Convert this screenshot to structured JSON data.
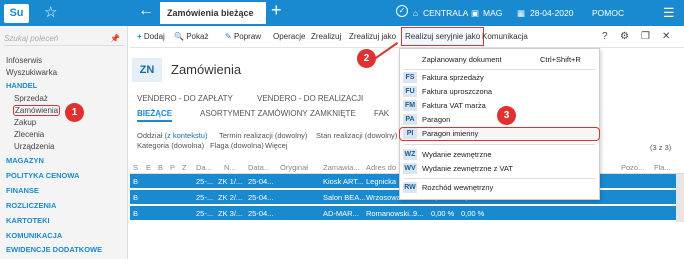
{
  "app": {
    "logo": "Su",
    "tab_title": "Zamówienia bieżące",
    "status": {
      "centrala": "CENTRALA",
      "mag": "MAG",
      "date": "28-04-2020",
      "help": "POMOC"
    }
  },
  "sidebar": {
    "search_placeholder": "Szukaj poleceń",
    "items": [
      "Infoserwis",
      "Wyszukiwarka"
    ],
    "handel_header": "HANDEL",
    "handel_items": [
      "Sprzedaż",
      "Zamówienia",
      "Zakup",
      "Zlecenia",
      "Urządzenia"
    ],
    "sections": [
      "MAGAZYN",
      "POLITYKA CENOWA",
      "FINANSE",
      "ROZLICZENIA",
      "KARTOTEKI",
      "KOMUNIKACJA",
      "EWIDENCJE DODATKOWE"
    ]
  },
  "toolbar": {
    "add": "Dodaj",
    "show": "Pokaż",
    "fix": "Popraw",
    "operations": "Operacje",
    "realize": "Zrealizuj",
    "realize_as": "Zrealizuj jako",
    "realize_serial_as": "Realizuj seryjnie jako",
    "communication": "Komunikacja",
    "help_q": "?"
  },
  "main": {
    "badge": "ZN",
    "title": "Zamówienia",
    "subtabs": [
      "VENDERO - DO ZAPŁATY",
      "VENDERO - DO REALIZACJI"
    ],
    "tabs": [
      "BIEŻĄCE",
      "ASORTYMENT ZAMÓWIONY",
      "ZAMKNIĘTE",
      "FAK"
    ],
    "filters": {
      "line1": [
        "Oddział",
        "(z kontekstu)",
        "Termin realizacji (dowolny)",
        "Stan realizacji (dowolny)",
        "Fa"
      ],
      "line2": [
        "Kategoria (dowolna)",
        "Flaga (dowolna)",
        "Więcej"
      ],
      "count": "(3 z 3)"
    }
  },
  "grid": {
    "headers": [
      "S",
      "E",
      "B",
      "P",
      "Z",
      "Da...",
      "N...",
      "Data...",
      "Oryginał",
      "Zamawia...",
      "Adres do",
      "Pozo...",
      "Fla..."
    ],
    "rows": [
      {
        "b": "B",
        "d": "25-...",
        "n": "ZK 1/...",
        "data": "25-04...",
        "zam": "Kiosk ART...",
        "adr": "Legnicka",
        "extra": "",
        "pct1": "",
        "pct2": ""
      },
      {
        "b": "B",
        "d": "25-...",
        "n": "ZK 2/...",
        "data": "25-04...",
        "zam": "Salon BEA...",
        "adr": "Wrzosowa 4...",
        "extra": "4...",
        "pct1": "0,00 %",
        "pct2": "0,00 %"
      },
      {
        "b": "B",
        "d": "25-...",
        "n": "ZK 3/...",
        "data": "25-04...",
        "zam": "AD-MAR...",
        "adr": "Romanowski...",
        "extra": "9...",
        "pct1": "0,00 %",
        "pct2": "0,00 %"
      }
    ]
  },
  "dropdown": {
    "items": [
      {
        "code": "",
        "label": "Zaplanowany dokument",
        "shortcut": "Ctrl+Shift+R"
      },
      {
        "code": "FS",
        "label": "Faktura sprzedaży"
      },
      {
        "code": "FU",
        "label": "Faktura uproszczona"
      },
      {
        "code": "FM",
        "label": "Faktura VAT marża"
      },
      {
        "code": "PA",
        "label": "Paragon"
      },
      {
        "code": "PI",
        "label": "Paragon imienny"
      },
      {
        "code": "WZ",
        "label": "Wydanie zewnętrzne"
      },
      {
        "code": "WV",
        "label": "Wydanie zewnętrzne z VAT"
      },
      {
        "code": "RW",
        "label": "Rozchód wewnętrzny"
      }
    ]
  },
  "markers": [
    "1",
    "2",
    "3"
  ],
  "colors": {
    "accent": "#1a8ad0",
    "marker": "#e03030"
  }
}
